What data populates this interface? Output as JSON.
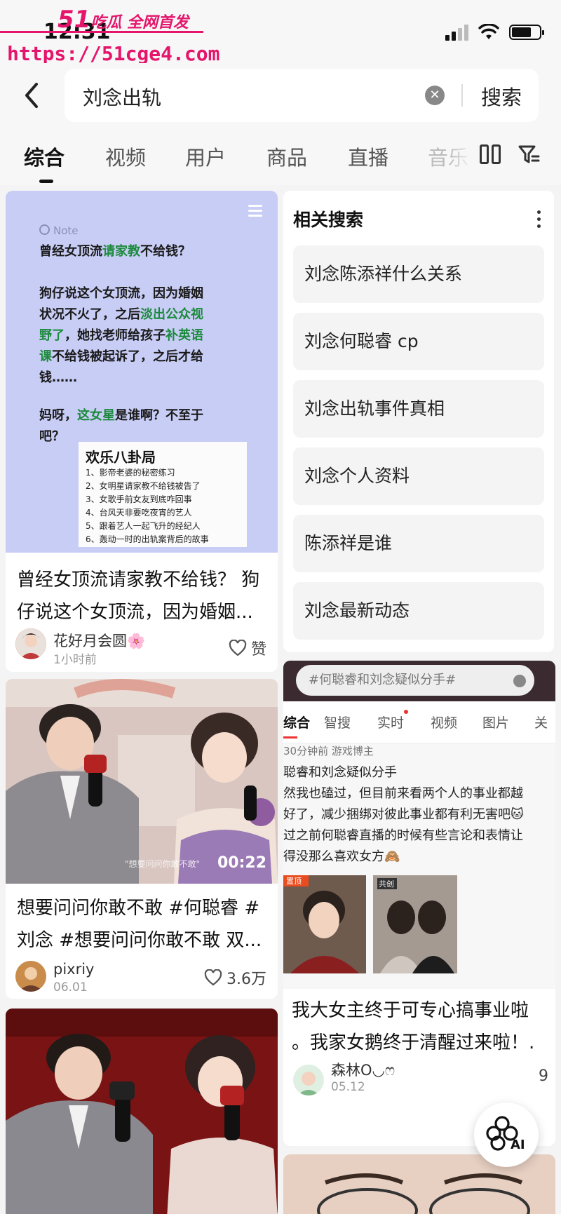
{
  "status": {
    "time": "12:31"
  },
  "watermark": {
    "logo_num": "51",
    "logo_text": "吃瓜 全网首发",
    "url": "https://51cge4.com"
  },
  "search": {
    "query": "刘念出轨",
    "button": "搜索"
  },
  "tabs": [
    "综合",
    "视频",
    "用户",
    "商品",
    "直播",
    "音乐"
  ],
  "note_image": {
    "label": "Note",
    "para1_a": "曾经女顶流",
    "para1_b": "请家教",
    "para1_c": "不给钱？",
    "para2_a": "狗仔说这个女顶流，因为婚姻",
    "para2_b": "状况不火了，之后",
    "para2_c": "淡出公众视",
    "para2_d": "野了",
    "para2_e": "，她找老师给孩子",
    "para2_f": "补英语",
    "para2_g": "课",
    "para2_h": "不给钱被起诉了，之后才给",
    "para2_i": "钱……",
    "para3_a": "妈呀，",
    "para3_b": "这女星",
    "para3_c": "是谁啊？不至于",
    "para3_d": "吧？",
    "paper_title": "欢乐八卦局",
    "paper_items": [
      "1、影帝老婆的秘密练习",
      "2、女明星请家教不给钱被告了",
      "3、女歌手前女友到底咋回事",
      "4、台风天非要吃夜宵的艺人",
      "5、跟着艺人一起飞升的经纪人",
      "6、轰动一时的出轨案背后的故事"
    ]
  },
  "cards": [
    {
      "title1": "曾经女顶流请家教不给钱？ 狗",
      "title2": "仔说这个女顶流，因为婚姻...",
      "author": "花好月会圆🌸",
      "time": "1小时前",
      "likes": "赞"
    },
    {
      "duration": "00:22",
      "title1": "想要问问你敢不敢 #何聪睿 #",
      "title2": "刘念 #想要问问你敢不敢 双...",
      "author": "pixriy",
      "time": "06.01",
      "likes": "3.6万"
    },
    {
      "title1": "我大女主终于可专心搞事业啦",
      "title2": "。我家女鹅终于清醒过来啦！.",
      "author": "森林O◡ෆ",
      "time": "05.12",
      "likes": "9"
    }
  ],
  "related": {
    "heading": "相关搜索",
    "items": [
      "刘念陈添祥什么关系",
      "刘念何聪睿 cp",
      "刘念出轨事件真相",
      "刘念个人资料",
      "陈添祥是谁",
      "刘念最新动态"
    ]
  },
  "shot": {
    "search_text": "#何聪睿和刘念疑似分手#",
    "tabs": [
      "综合",
      "智搜",
      "实时",
      "视频",
      "图片",
      "关"
    ],
    "meta": "30分钟前   游戏博主",
    "lines": [
      "聪睿和刘念疑似分手",
      "然我也磕过，但目前来看两个人的事业都越",
      "好了，减少捆绑对彼此事业都有利无害吧🐱",
      "过之前何聪睿直播的时候有些言论和表情让",
      "得没那么喜欢女方🙈"
    ],
    "pic_labels": [
      "置顶",
      "共创"
    ]
  },
  "ai": {
    "label": "AI"
  },
  "colors": {
    "watermark": "#e4156b",
    "note_bg": "#c8cdf5",
    "highlight_green": "#1c8a3d"
  }
}
